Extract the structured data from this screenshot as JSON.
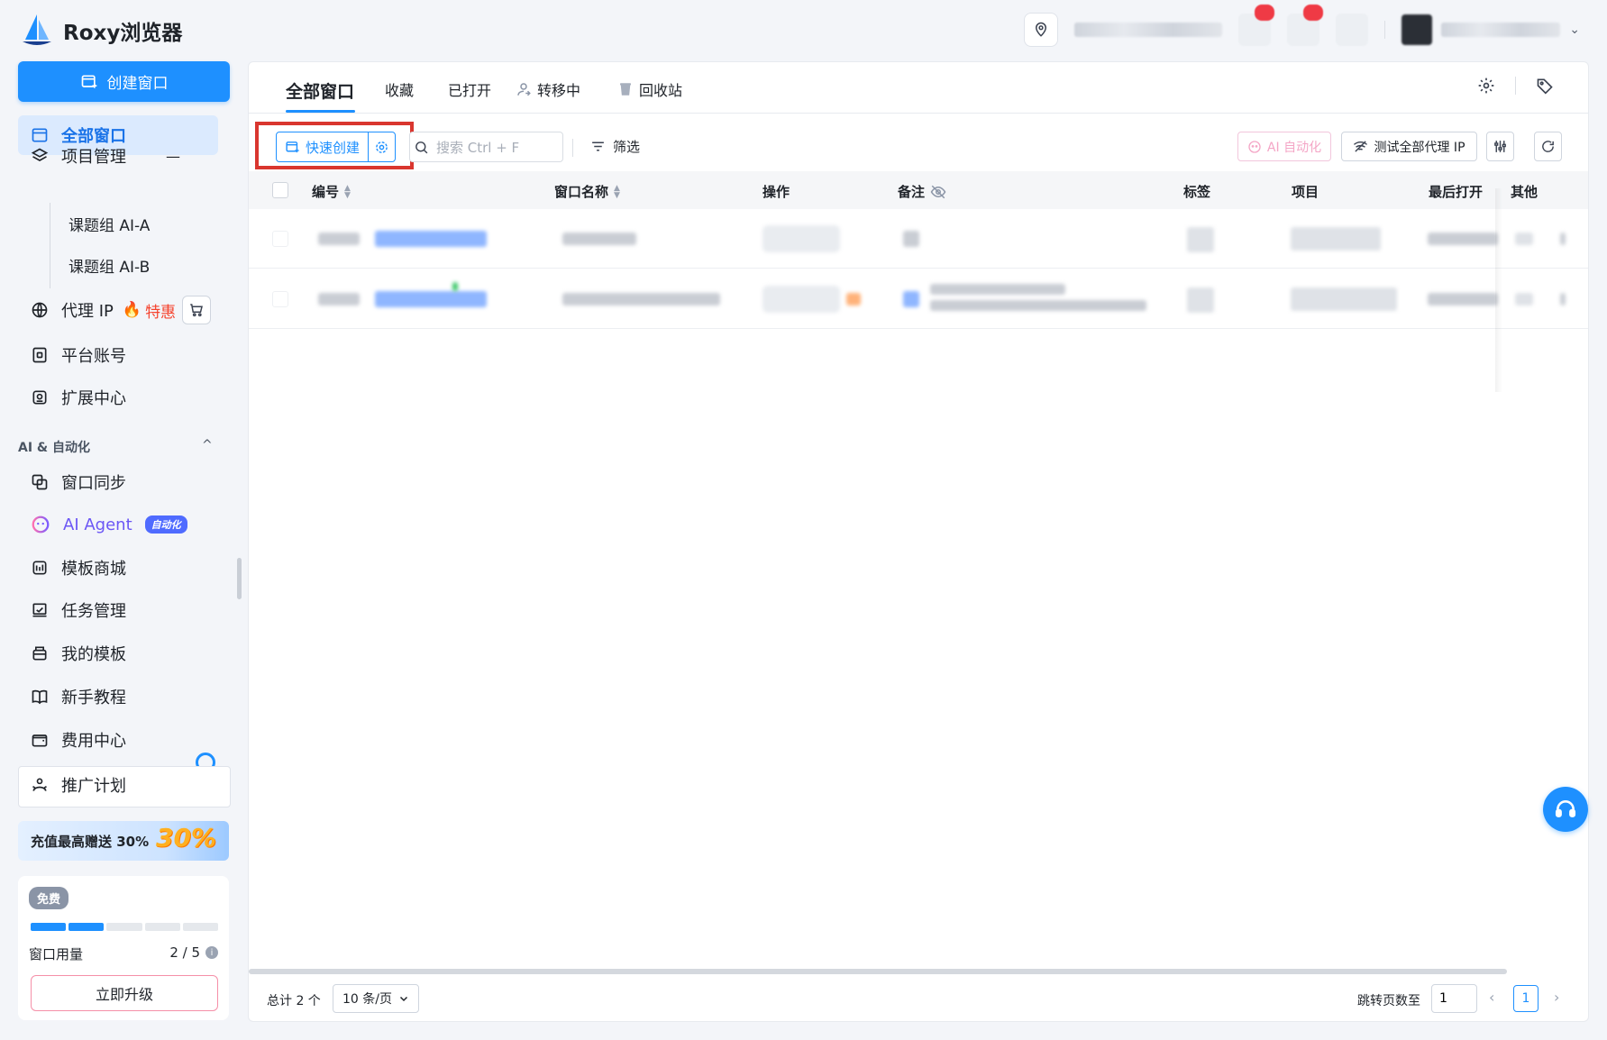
{
  "app": {
    "name": "Roxy浏览器",
    "brand_color": "#1e90ff",
    "accent_alert": "#d9362f"
  },
  "header": {
    "location_icon": "map-pin-icon",
    "user_menu_chevron": "⌄"
  },
  "sidebar": {
    "create_button": "创建窗口",
    "items": [
      {
        "label": "全部窗口",
        "icon": "window-icon",
        "active": true
      },
      {
        "label": "项目管理",
        "icon": "layers-icon",
        "toggle": "—"
      },
      {
        "label": "代理 IP",
        "icon": "globe-icon",
        "hot": "特惠"
      },
      {
        "label": "平台账号",
        "icon": "account-icon"
      },
      {
        "label": "扩展中心",
        "icon": "extension-icon"
      }
    ],
    "project_groups": [
      "课题组 AI-A",
      "课题组 AI-B"
    ],
    "section_title": "AI & 自动化",
    "section_chevron": "^",
    "ai_items": [
      {
        "label": "窗口同步",
        "icon": "sync-windows-icon"
      },
      {
        "label": "AI Agent",
        "icon": "ai-agent-icon",
        "badge": "自动化"
      },
      {
        "label": "模板商城",
        "icon": "template-store-icon"
      },
      {
        "label": "任务管理",
        "icon": "task-icon"
      },
      {
        "label": "我的模板",
        "icon": "my-template-icon"
      },
      {
        "label": "新手教程",
        "icon": "book-icon"
      },
      {
        "label": "费用中心",
        "icon": "wallet-icon"
      },
      {
        "label": "推广计划",
        "icon": "referral-icon"
      }
    ],
    "banner_text": "充值最高赠送 30%",
    "banner_art": "30%",
    "plan": {
      "badge": "免费",
      "usage_label": "窗口用量",
      "usage_value": "2 / 5",
      "used": 2,
      "total": 5,
      "upgrade_button": "立即升级"
    }
  },
  "main": {
    "tabs": [
      {
        "label": "全部窗口",
        "active": true
      },
      {
        "label": "收藏"
      },
      {
        "label": "已打开"
      },
      {
        "label": "转移中",
        "icon": "transfer-user-icon"
      },
      {
        "label": "回收站",
        "icon": "trash-icon"
      }
    ],
    "toolbar": {
      "quick_create": "快速创建",
      "search_placeholder": "搜索 Ctrl + F",
      "filter": "筛选",
      "ai_automation": "AI 自动化",
      "test_proxy": "测试全部代理 IP"
    },
    "table": {
      "columns": [
        "编号",
        "窗口名称",
        "操作",
        "备注",
        "标签",
        "项目",
        "最后打开",
        "其他"
      ],
      "row_count": 2
    },
    "footer": {
      "total": "总计 2 个",
      "page_size": "10 条/页",
      "jump_label": "跳转页数至",
      "jump_value": "1",
      "current_page": "1",
      "prev": "‹",
      "next": "›"
    }
  }
}
